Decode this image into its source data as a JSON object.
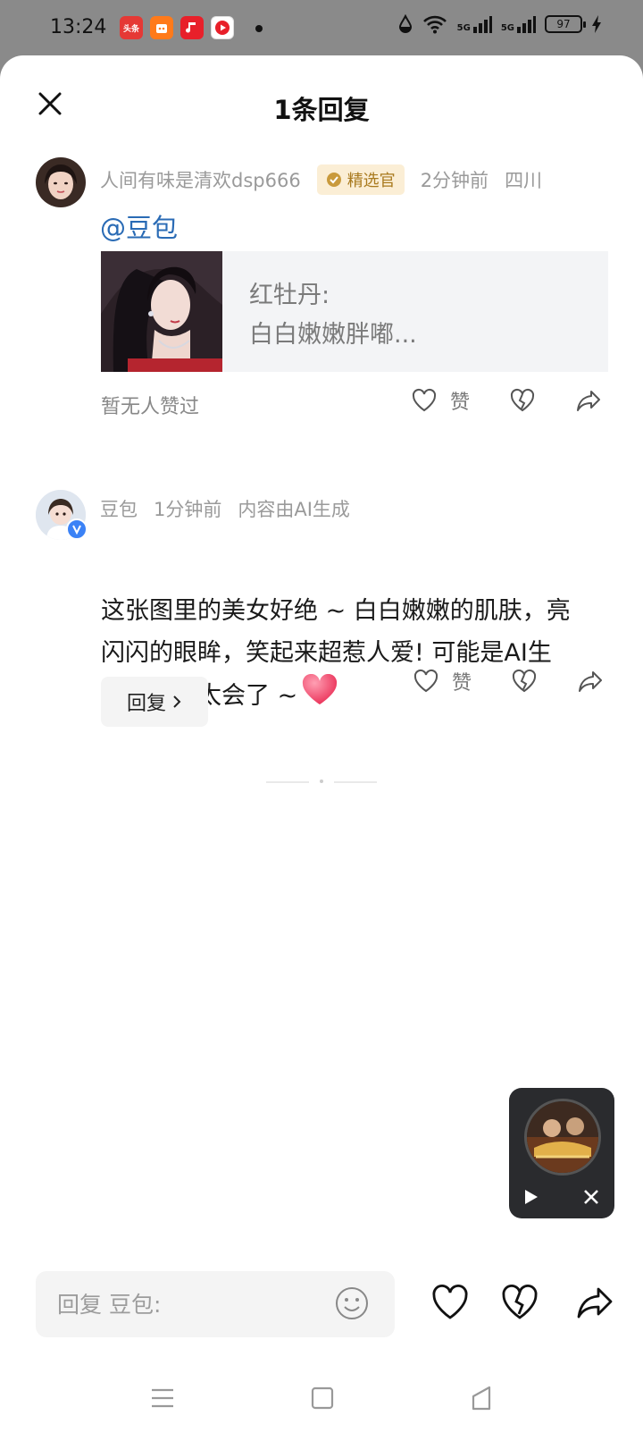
{
  "status_bar": {
    "time": "13:24",
    "apps": [
      {
        "icon": "toutiao-app-icon",
        "label": "头条",
        "color": "#e53935"
      },
      {
        "icon": "shopping-app-icon",
        "label": "",
        "color": "#ff7a1a"
      },
      {
        "icon": "music-app-icon",
        "label": "",
        "color": "#e8202a"
      },
      {
        "icon": "video-app-icon",
        "label": "",
        "color": "#e8202a"
      }
    ],
    "signal_1": "5G",
    "signal_2": "5G",
    "battery": "97"
  },
  "sheet": {
    "title": "1条回复",
    "close_icon": "close-icon"
  },
  "parent_comment": {
    "username": "人间有味是清欢dsp666",
    "badge": "精选官",
    "time": "2分钟前",
    "location": "四川",
    "mention": "@豆包",
    "quote_title": "红牡丹:",
    "quote_excerpt": "白白嫩嫩胖嘟...",
    "no_likes": "暂无人赞过",
    "like_label": "赞"
  },
  "reply": {
    "username": "豆包",
    "time": "1分钟前",
    "ai_note": "内容由AI生成",
    "text": "这张图里的美女好绝 ~ 白白嫩嫩的肌肤，亮闪闪的眼眸，笑起来超惹人爱! 可能是AI生成的吧，太会了 ~",
    "emoji": "red-heart-emoji",
    "reply_button": "回复",
    "like_label": "赞"
  },
  "bottom_bar": {
    "placeholder": "回复 豆包:"
  },
  "colors": {
    "link_blue": "#2a6bb5",
    "badge_gold": "#a97a1e",
    "heart_red": "#f2476a"
  }
}
